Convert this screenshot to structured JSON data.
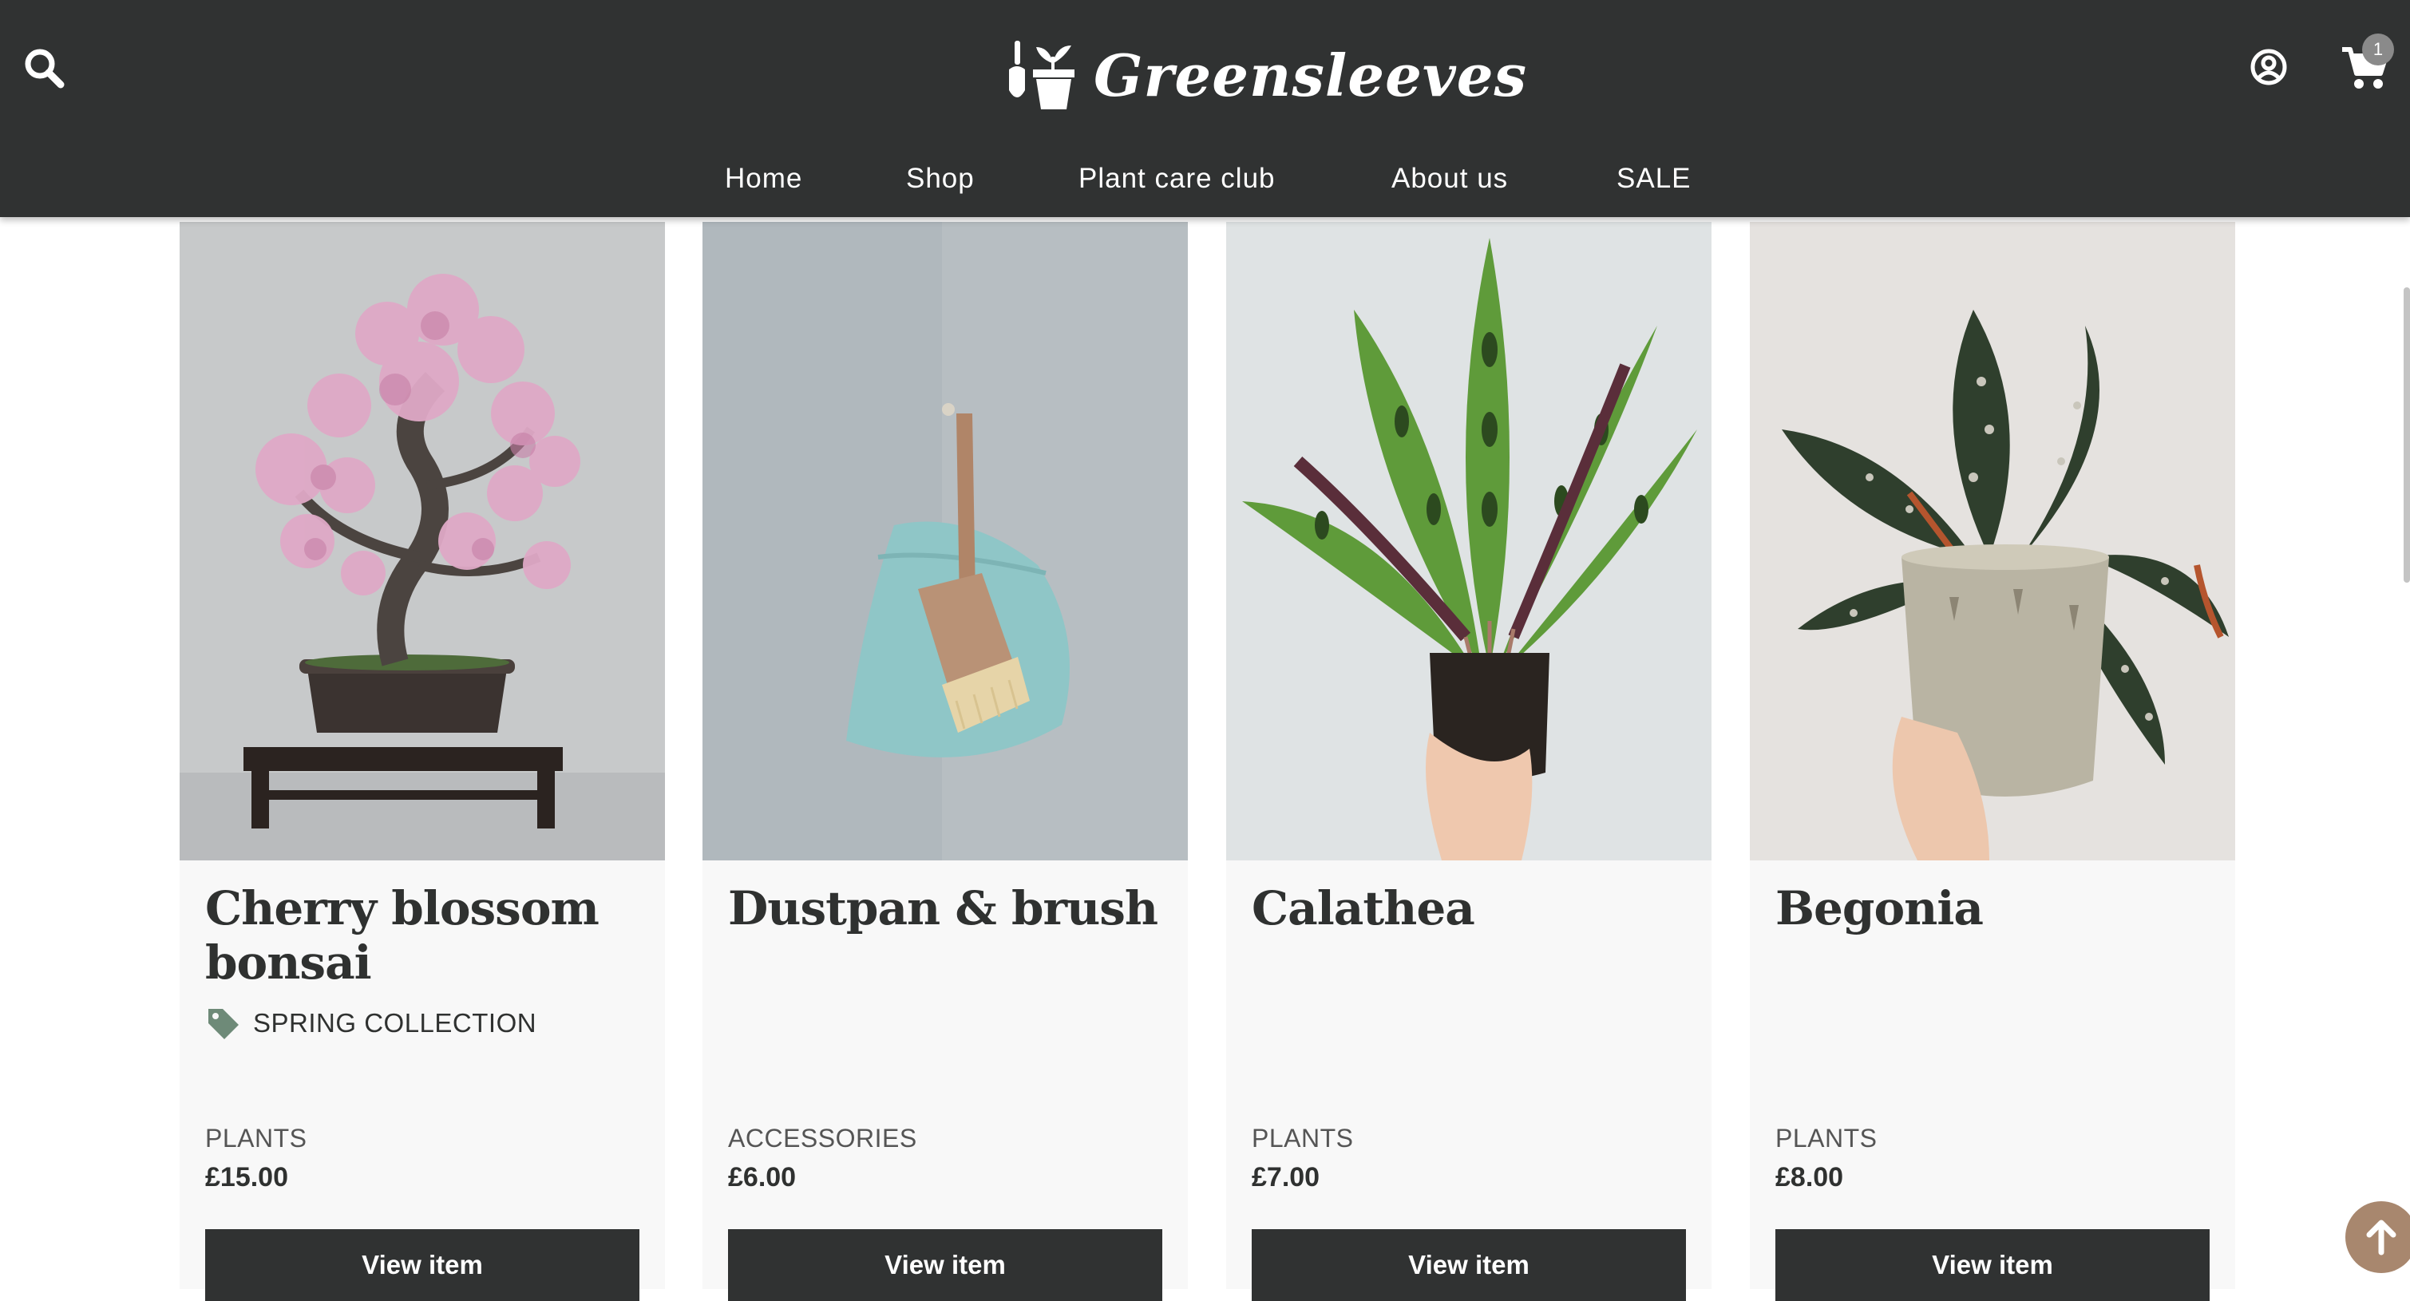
{
  "header": {
    "brand": "Greensleeves",
    "cart_count": "1",
    "nav": [
      "Home",
      "Shop",
      "Plant care club",
      "About us",
      "SALE"
    ]
  },
  "products": [
    {
      "title": "Cherry blossom bonsai",
      "tag": "SPRING COLLECTION",
      "category": "PLANTS",
      "price": "£15.00",
      "button": "View item",
      "image": "cherry-blossom-bonsai-photo"
    },
    {
      "title": "Dustpan & brush",
      "tag": "",
      "category": "ACCESSORIES",
      "price": "£6.00",
      "button": "View item",
      "image": "dustpan-and-brush-photo"
    },
    {
      "title": "Calathea",
      "tag": "",
      "category": "PLANTS",
      "price": "£7.00",
      "button": "View item",
      "image": "calathea-plant-photo"
    },
    {
      "title": "Begonia",
      "tag": "",
      "category": "PLANTS",
      "price": "£8.00",
      "button": "View item",
      "image": "begonia-plant-photo"
    }
  ],
  "colors": {
    "header_bg": "#303232",
    "button_bg": "#303232",
    "tag_icon": "#6e8a78",
    "back_to_top": "#a8876e"
  },
  "icons": [
    "search-icon",
    "logo-icon",
    "account-icon",
    "cart-icon",
    "tag-icon",
    "arrow-up-icon"
  ]
}
